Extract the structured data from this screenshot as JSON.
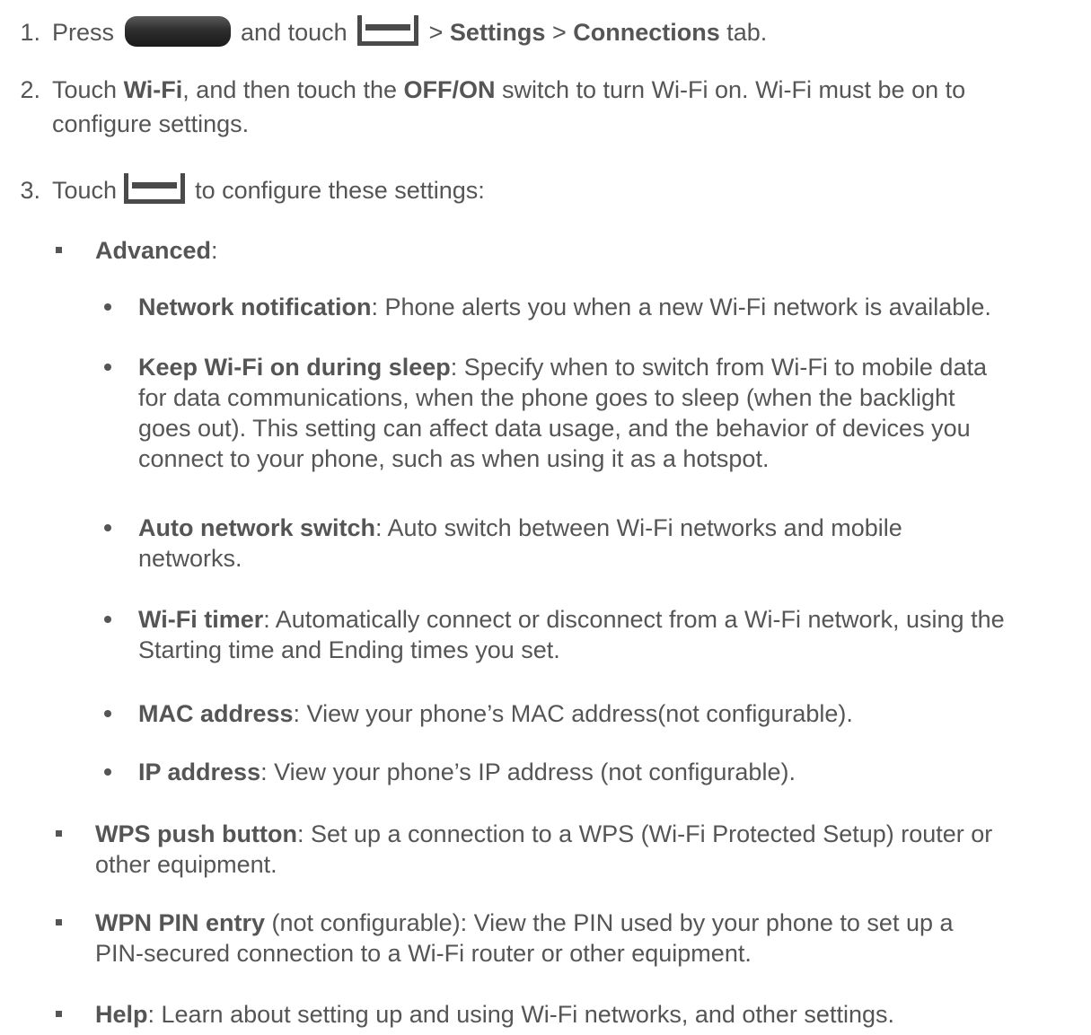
{
  "steps": [
    {
      "num": "1.",
      "p1": "Press ",
      "p2": " and touch ",
      "p3": " > ",
      "b1": "Settings",
      "p4": " > ",
      "b2": "Connections",
      "p5": " tab."
    },
    {
      "num": "2.",
      "p1": "Touch ",
      "b1": "Wi-Fi",
      "p2": ", and then touch the ",
      "b2": "OFF/ON",
      "p3": " switch to turn Wi-Fi on. Wi-Fi must be on to",
      "line2": "configure settings."
    },
    {
      "num": "3.",
      "p1": "Touch ",
      "p2": " to configure these settings:"
    }
  ],
  "advanced": {
    "label": "Advanced",
    "suffix": ":"
  },
  "advanced_items": [
    {
      "label": "Network notification",
      "lines": [
        ": Phone alerts you when a new Wi-Fi network is available."
      ]
    },
    {
      "label": "Keep Wi-Fi on during sleep",
      "lines": [
        ": Specify when to switch from Wi-Fi to mobile data",
        "for data communications, when the phone goes to sleep (when the backlight",
        "goes out). This setting can affect data usage, and the behavior of devices you",
        "connect to your phone, such as when using it as a hotspot."
      ]
    },
    {
      "label": "Auto network switch",
      "lines": [
        ": Auto switch between Wi-Fi networks and mobile",
        "networks."
      ]
    },
    {
      "label": "Wi-Fi timer",
      "lines": [
        ": Automatically connect or disconnect from a Wi-Fi network, using the",
        "Starting time and Ending times you set."
      ]
    },
    {
      "label": "MAC address",
      "lines": [
        ": View your phone’s MAC address(not configurable)."
      ]
    },
    {
      "label": "IP address",
      "lines": [
        ": View your phone’s IP address (not configurable)."
      ]
    }
  ],
  "other_items": [
    {
      "label": "WPS push button",
      "lines": [
        ": Set up a connection to a WPS (Wi-Fi Protected Setup) router or",
        "other equipment."
      ]
    },
    {
      "label": "WPN PIN entry",
      "lines": [
        " (not configurable): View the PIN used by your phone to set up a",
        "PIN-secured connection to a Wi-Fi router or other equipment."
      ]
    },
    {
      "label": "Help",
      "lines": [
        ": Learn about setting up and using Wi-Fi networks, and other settings."
      ]
    }
  ],
  "icons": {
    "home": "home-button-icon",
    "menu": "menu-icon"
  }
}
